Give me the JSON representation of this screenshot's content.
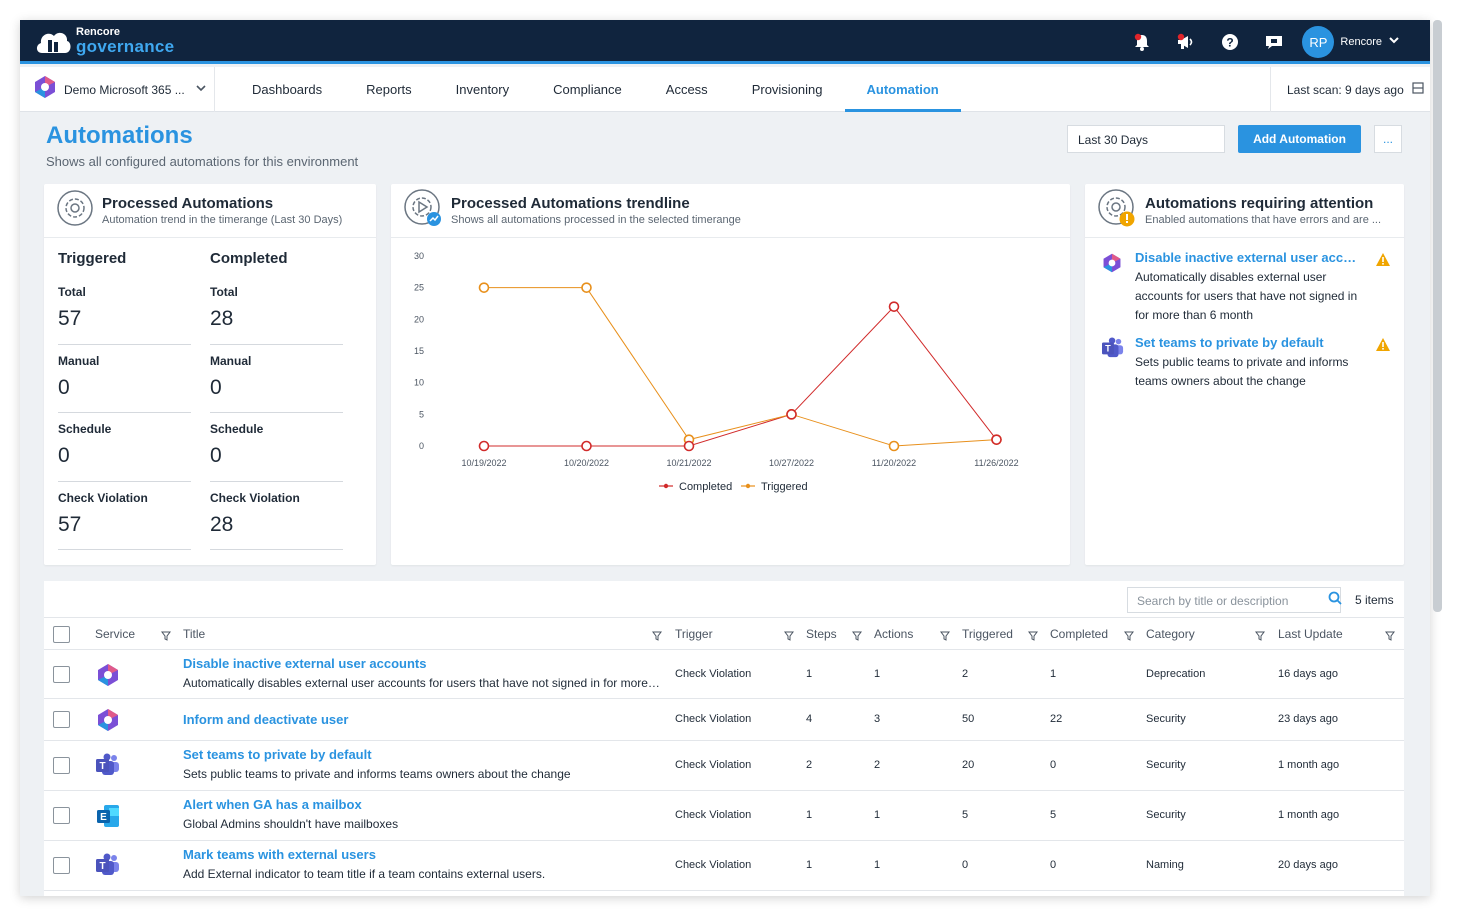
{
  "app": {
    "logo_small": "Rencore",
    "logo_big": "governance",
    "user_initials": "RP",
    "user_name": "Rencore"
  },
  "topbar_icons": [
    "notification-bell-icon",
    "announcement-megaphone-icon",
    "help-icon",
    "feedback-icon"
  ],
  "nav": {
    "tenant": "Demo Microsoft 365 ...",
    "tabs": [
      {
        "label": "Dashboards",
        "active": false
      },
      {
        "label": "Reports",
        "active": false
      },
      {
        "label": "Inventory",
        "active": false
      },
      {
        "label": "Compliance",
        "active": false
      },
      {
        "label": "Access",
        "active": false
      },
      {
        "label": "Provisioning",
        "active": false
      },
      {
        "label": "Automation",
        "active": true
      }
    ],
    "last_scan": "Last scan: 9 days ago"
  },
  "header": {
    "title": "Automations",
    "subtitle": "Shows all configured automations for this environment",
    "time_range": "Last 30 Days",
    "add_button": "Add Automation",
    "more_button": "..."
  },
  "processed": {
    "title": "Processed Automations",
    "subtitle": "Automation trend in the timerange (Last 30 Days)",
    "triggered": {
      "heading": "Triggered",
      "items": [
        {
          "label": "Total",
          "value": "57"
        },
        {
          "label": "Manual",
          "value": "0"
        },
        {
          "label": "Schedule",
          "value": "0"
        },
        {
          "label": "Check Violation",
          "value": "57"
        }
      ]
    },
    "completed": {
      "heading": "Completed",
      "items": [
        {
          "label": "Total",
          "value": "28"
        },
        {
          "label": "Manual",
          "value": "0"
        },
        {
          "label": "Schedule",
          "value": "0"
        },
        {
          "label": "Check Violation",
          "value": "28"
        }
      ]
    }
  },
  "trendline": {
    "title": "Processed Automations trendline",
    "subtitle": "Shows all automations processed in the selected timerange"
  },
  "chart_data": {
    "type": "line",
    "x": [
      "10/19/2022",
      "10/20/2022",
      "10/21/2022",
      "10/27/2022",
      "11/20/2022",
      "11/26/2022"
    ],
    "series": [
      {
        "name": "Completed",
        "color": "#d12b2b",
        "values": [
          0,
          0,
          0,
          5,
          22,
          1
        ]
      },
      {
        "name": "Triggered",
        "color": "#e8901c",
        "values": [
          25,
          25,
          1,
          5,
          0,
          1
        ]
      }
    ],
    "yticks": [
      0,
      5,
      10,
      15,
      20,
      25,
      30
    ],
    "ylim": [
      0,
      30
    ],
    "legend": "bottom",
    "grid": false
  },
  "attention": {
    "title": "Automations requiring attention",
    "subtitle": "Enabled automations that have errors and are ...",
    "items": [
      {
        "title": "Disable inactive external user acco...",
        "desc": "Automatically disables external user accounts for users that have not signed in for more than 6 month",
        "icon": "microsoft365-icon"
      },
      {
        "title": "Set teams to private by default",
        "desc": "Sets public teams to private and informs teams owners about the change",
        "icon": "teams-icon"
      }
    ]
  },
  "table": {
    "search_placeholder": "Search by title or description",
    "count": "5 items",
    "columns": [
      "Service",
      "Title",
      "Trigger",
      "Steps",
      "Actions",
      "Triggered",
      "Completed",
      "Category",
      "Last Update"
    ],
    "rows": [
      {
        "service": "microsoft365-icon",
        "title": "Disable inactive external user accounts",
        "desc": "Automatically disables external user accounts for users that have not signed in for more t...",
        "trigger": "Check Violation",
        "steps": "1",
        "actions": "1",
        "triggered": "2",
        "completed": "1",
        "category": "Deprecation",
        "updated": "16 days ago"
      },
      {
        "service": "microsoft365-icon",
        "title": "Inform and deactivate user",
        "desc": "",
        "trigger": "Check Violation",
        "steps": "4",
        "actions": "3",
        "triggered": "50",
        "completed": "22",
        "category": "Security",
        "updated": "23 days ago"
      },
      {
        "service": "teams-icon",
        "title": "Set teams to private by default",
        "desc": "Sets public teams to private and informs teams owners about the change",
        "trigger": "Check Violation",
        "steps": "2",
        "actions": "2",
        "triggered": "20",
        "completed": "0",
        "category": "Security",
        "updated": "1 month ago"
      },
      {
        "service": "exchange-icon",
        "title": "Alert when GA has a mailbox",
        "desc": "Global Admins shouldn't have mailboxes",
        "trigger": "Check Violation",
        "steps": "1",
        "actions": "1",
        "triggered": "5",
        "completed": "5",
        "category": "Security",
        "updated": "1 month ago"
      },
      {
        "service": "teams-icon",
        "title": "Mark teams with external users",
        "desc": "Add External indicator to team title if a team contains external users.",
        "trigger": "Check Violation",
        "steps": "1",
        "actions": "1",
        "triggered": "0",
        "completed": "0",
        "category": "Naming",
        "updated": "20 days ago"
      }
    ]
  }
}
